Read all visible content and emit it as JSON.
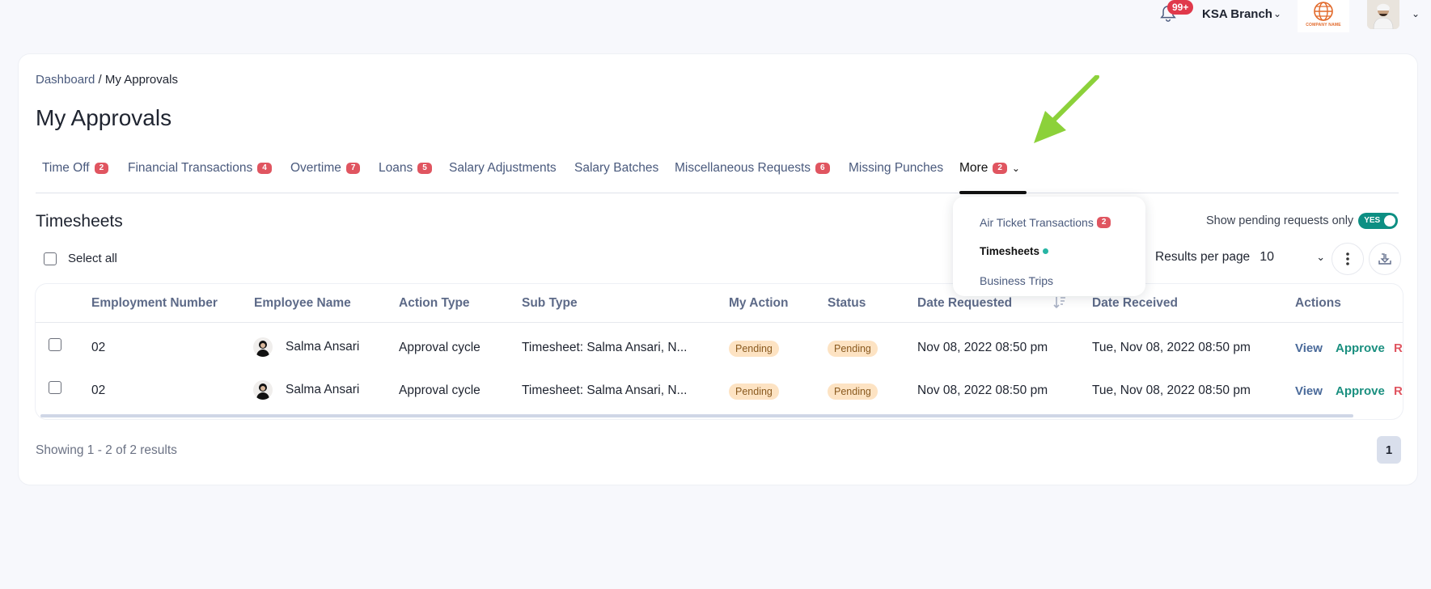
{
  "header": {
    "notifications_badge": "99+",
    "branch_label": "KSA Branch",
    "company_logo_text": "COMPANY NAME"
  },
  "breadcrumb": {
    "root": "Dashboard",
    "separator": " / ",
    "current": "My Approvals"
  },
  "page_title": "My Approvals",
  "tabs": [
    {
      "label": "Time Off",
      "badge": "2"
    },
    {
      "label": "Financial Transactions",
      "badge": "4"
    },
    {
      "label": "Overtime",
      "badge": "7"
    },
    {
      "label": "Loans",
      "badge": "5"
    },
    {
      "label": "Salary Adjustments",
      "badge": ""
    },
    {
      "label": "Salary Batches",
      "badge": ""
    },
    {
      "label": "Miscellaneous Requests",
      "badge": "6"
    },
    {
      "label": "Missing Punches",
      "badge": ""
    },
    {
      "label": "More",
      "badge": "2",
      "active": true
    }
  ],
  "more_menu": [
    {
      "label": "Air Ticket Transactions",
      "badge": "2"
    },
    {
      "label": "Timesheets",
      "active": true
    },
    {
      "label": "Business Trips"
    }
  ],
  "section": {
    "title": "Timesheets",
    "select_all_label": "Select all",
    "pending_only_label": "Show pending requests only",
    "toggle_label": "YES",
    "results_per_page_label": "Results per page",
    "results_per_page_value": "10"
  },
  "table": {
    "columns": [
      "Employment Number",
      "Employee Name",
      "Action Type",
      "Sub Type",
      "My Action",
      "Status",
      "Date Requested",
      "Date Received",
      "Actions"
    ],
    "rows": [
      {
        "employment_number": "02",
        "employee_name": "Salma Ansari",
        "action_type": "Approval cycle",
        "sub_type": "Timesheet: Salma Ansari, N...",
        "my_action": "Pending",
        "status": "Pending",
        "date_requested": "Nov 08, 2022 08:50 pm",
        "date_received": "Tue, Nov 08, 2022 08:50 pm",
        "actions": {
          "view": "View",
          "approve": "Approve",
          "reject": "R"
        }
      },
      {
        "employment_number": "02",
        "employee_name": "Salma Ansari",
        "action_type": "Approval cycle",
        "sub_type": "Timesheet: Salma Ansari, N...",
        "my_action": "Pending",
        "status": "Pending",
        "date_requested": "Nov 08, 2022 08:50 pm",
        "date_received": "Tue, Nov 08, 2022 08:50 pm",
        "actions": {
          "view": "View",
          "approve": "Approve",
          "reject": "R"
        }
      }
    ]
  },
  "footer": {
    "showing_text": "Showing 1 - 2 of 2 results",
    "current_page": "1"
  },
  "colors": {
    "accent": "#0d8f83",
    "badge": "#e05560",
    "pending_bg": "#fde3c3",
    "annotation_arrow": "#8cd13a"
  },
  "icons": [
    "bell-icon",
    "globe-logo-icon",
    "chevron-down-icon",
    "kebab-menu-icon",
    "download-icon",
    "sort-icon"
  ]
}
